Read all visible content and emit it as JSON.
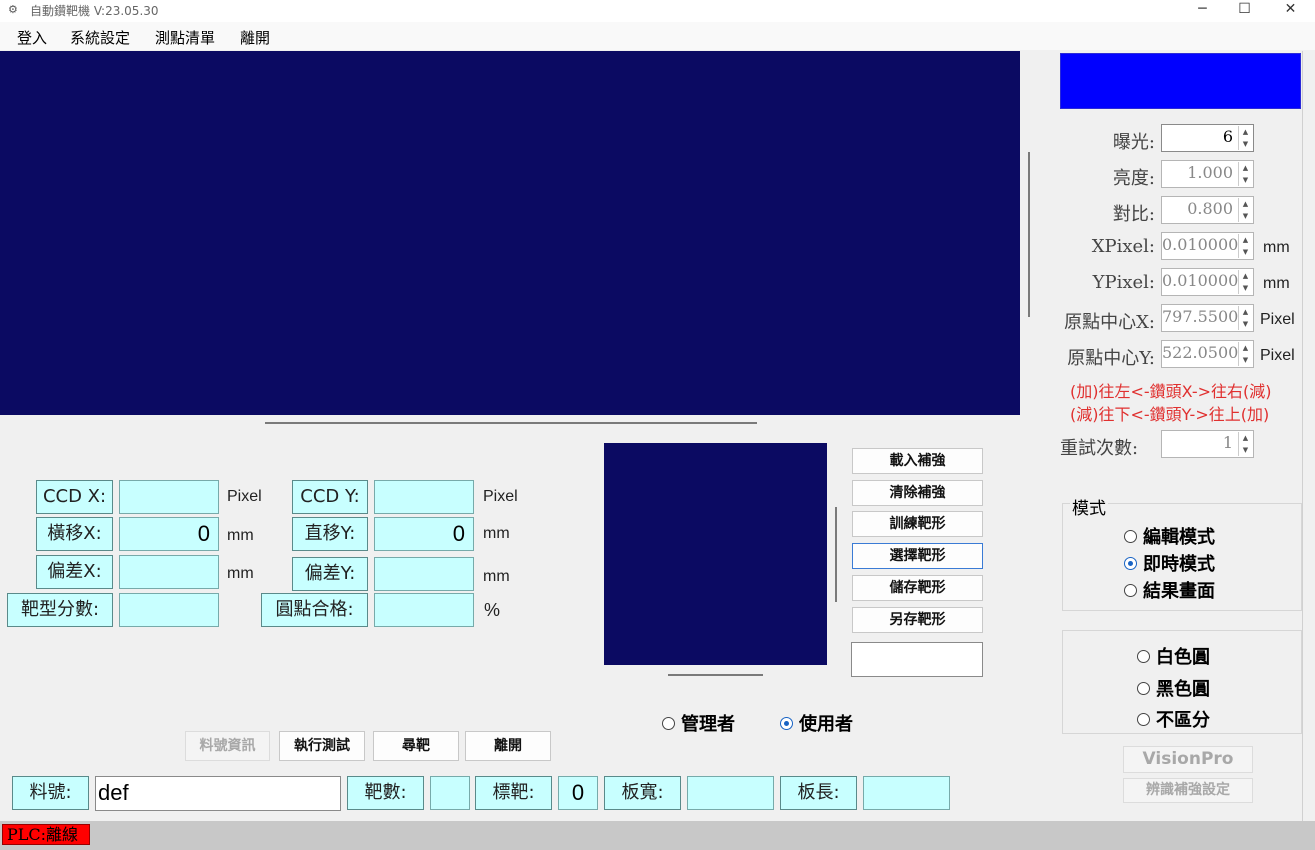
{
  "window": {
    "title": "自動鑽靶機 V:23.05.30",
    "minimize": "─",
    "maximize": "☐",
    "close": "✕"
  },
  "menu": {
    "login": "登入",
    "settings": "系統設定",
    "measure_list": "測點清單",
    "exit": "離開"
  },
  "camera": {
    "exposure": {
      "label": "曝光:",
      "value": "6"
    },
    "brightness": {
      "label": "亮度:",
      "value": "1.000"
    },
    "contrast": {
      "label": "對比:",
      "value": "0.800"
    },
    "xpixel": {
      "label": "XPixel:",
      "value": "0.010000",
      "unit": "mm"
    },
    "ypixel": {
      "label": "YPixel:",
      "value": "0.010000",
      "unit": "mm"
    },
    "origin_x": {
      "label": "原點中心X:",
      "value": "797.5500",
      "unit": "Pixel"
    },
    "origin_y": {
      "label": "原點中心Y:",
      "value": "522.0500",
      "unit": "Pixel"
    },
    "note1": "(加)往左<-鑽頭X->往右(減)",
    "note2": "(減)往下<-鑽頭Y->往上(加)",
    "retry": {
      "label": "重試次數:",
      "value": "1"
    }
  },
  "mode": {
    "title": "模式",
    "options": [
      "編輯模式",
      "即時模式",
      "結果畫面"
    ],
    "selected": 1
  },
  "circle": {
    "options": [
      "白色圓",
      "黑色圓",
      "不區分"
    ]
  },
  "vision": {
    "visionpro": "VisionPro",
    "enhance": "辨識補強設定"
  },
  "measure": {
    "ccd_x": {
      "label": "CCD X:",
      "value": "",
      "unit": "Pixel"
    },
    "ccd_y": {
      "label": "CCD Y:",
      "value": "",
      "unit": "Pixel"
    },
    "shift_x": {
      "label": "橫移X:",
      "value": "0",
      "unit": "mm"
    },
    "shift_y": {
      "label": "直移Y:",
      "value": "0",
      "unit": "mm"
    },
    "dev_x": {
      "label": "偏差X:",
      "value": "",
      "unit": "mm"
    },
    "dev_y": {
      "label": "偏差Y:",
      "value": "",
      "unit": "mm"
    },
    "score": {
      "label": "靶型分數:",
      "value": ""
    },
    "round_pass": {
      "label": "圓點合格:",
      "value": "",
      "unit": "%"
    }
  },
  "pattern_buttons": [
    "載入補強",
    "清除補強",
    "訓練靶形",
    "選擇靶形",
    "儲存靶形",
    "另存靶形"
  ],
  "role": {
    "admin": "管理者",
    "user": "使用者",
    "selected": "user"
  },
  "actions": {
    "part_info": "料號資訊",
    "run_test": "執行測試",
    "find_target": "尋靶",
    "leave": "離開"
  },
  "bottom": {
    "part_label": "料號:",
    "part_value": "def",
    "target_count_label": "靶數:",
    "target_count_value": "",
    "target_label": "標靶:",
    "target_value": "0",
    "board_width_label": "板寬:",
    "board_width_value": "",
    "board_length_label": "板長:",
    "board_length_value": ""
  },
  "status": {
    "plc": "PLC:離線"
  },
  "colors": {
    "view_bg": "#0b0a62",
    "preview": "#0000ff",
    "field_bg": "#c8ffff",
    "plc_offline": "#ff0000"
  }
}
